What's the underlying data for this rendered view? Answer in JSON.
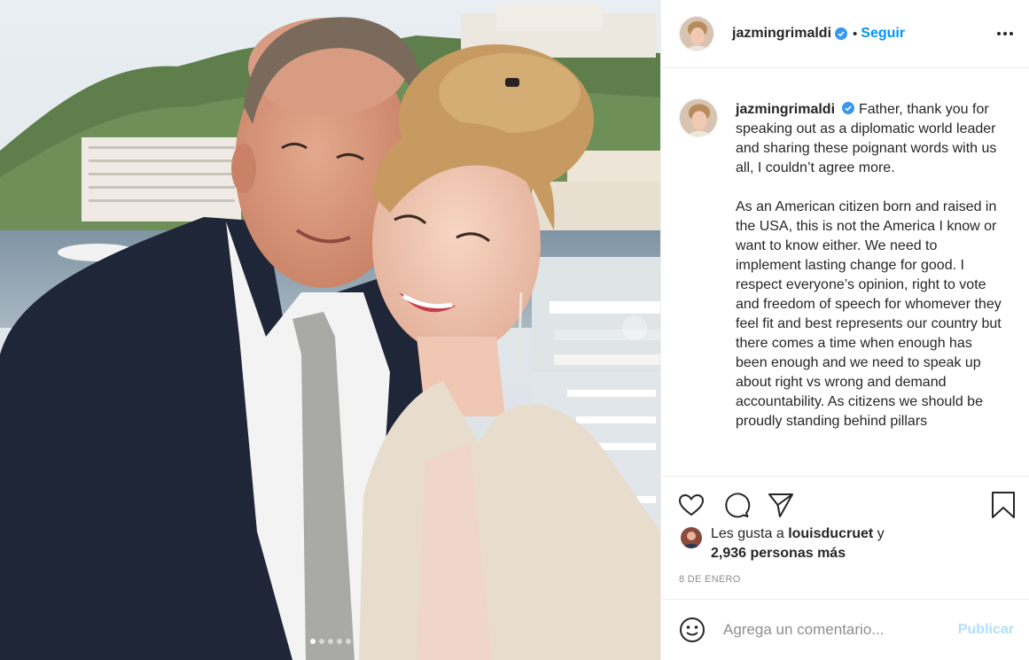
{
  "post": {
    "username": "jazmingrimaldi",
    "separator": "•",
    "follow_label": "Seguir",
    "caption_paragraphs": [
      "Father, thank you for speaking out as a diplomatic world leader and sharing these poignant words with us all, I couldn’t agree more.",
      "As an American citizen born and raised in the USA, this is not the America I know or want to know either. We need to implement lasting change for good. I respect everyone’s opinion, right to vote and freedom of speech for whomever they feel fit and best represents our country but there comes a time when enough has been enough and we need to speak up about right vs wrong and demand accountability. As citizens we should be proudly standing behind pillars"
    ],
    "likes": {
      "prefix": "Les gusta a",
      "liker": "louisducruet",
      "conjunction": "y",
      "others": "2,936 personas más"
    },
    "date": "8 DE ENERO",
    "carousel": {
      "count": 5,
      "active_index": 0
    }
  },
  "comment": {
    "placeholder": "Agrega un comentario...",
    "publish_label": "Publicar"
  },
  "icons": {
    "header": [
      "verified-badge-icon",
      "more-options-icon"
    ],
    "actions": [
      "heart-icon",
      "comment-icon",
      "share-icon",
      "bookmark-icon"
    ],
    "comment": [
      "emoji-icon"
    ]
  },
  "colors": {
    "accent": "#0095f6",
    "publish_disabled": "#b2dffc",
    "text": "#262626",
    "muted": "#8e8e8e",
    "border": "#efefef"
  }
}
